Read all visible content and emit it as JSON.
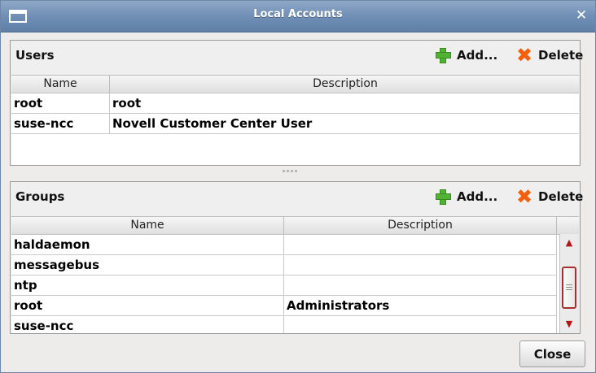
{
  "window": {
    "title": "Local Accounts",
    "close_label": "Close"
  },
  "users": {
    "title": "Users",
    "add_label": "Add...",
    "delete_label": "Delete",
    "columns": [
      "Name",
      "Description"
    ],
    "rows": [
      [
        "root",
        "root"
      ],
      [
        "suse-ncc",
        "Novell Customer Center User"
      ]
    ]
  },
  "groups": {
    "title": "Groups",
    "add_label": "Add...",
    "delete_label": "Delete",
    "columns": [
      "Name",
      "Description"
    ],
    "rows": [
      [
        "haldaemon",
        ""
      ],
      [
        "messagebus",
        ""
      ],
      [
        "ntp",
        ""
      ],
      [
        "root",
        "Administrators"
      ],
      [
        "suse-ncc",
        ""
      ]
    ]
  },
  "icons": {
    "title": "window-icon",
    "close": "close-icon",
    "add": "plus-icon",
    "delete": "delete-icon"
  },
  "colors": {
    "titlebar": "#6f8db5",
    "add_icon": "#52b234",
    "delete_icon": "#f45f0c",
    "scrollbar_accent": "#b01616"
  }
}
